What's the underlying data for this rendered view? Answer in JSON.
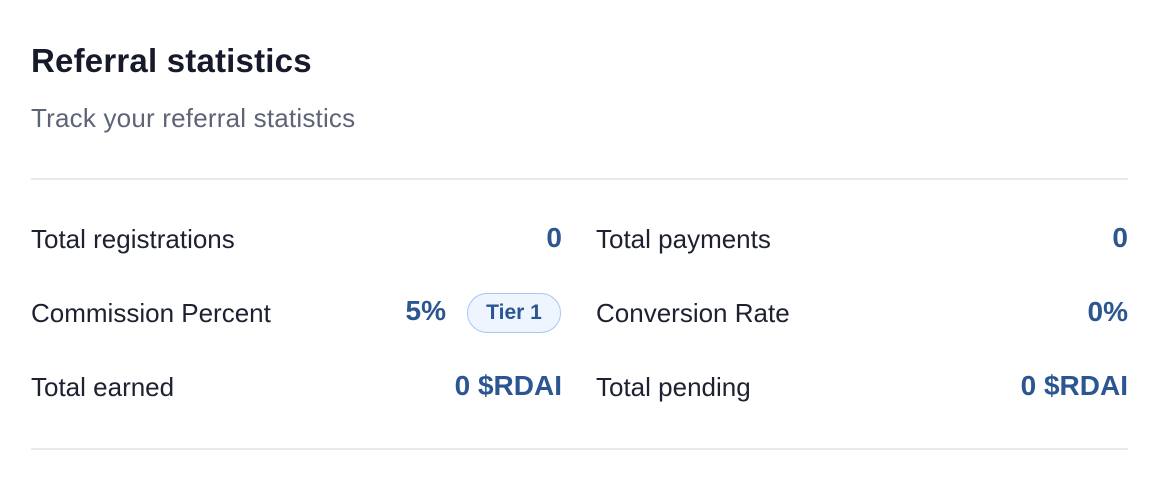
{
  "header": {
    "title": "Referral statistics",
    "subtitle": "Track your referral statistics"
  },
  "stats": {
    "total_registrations": {
      "label": "Total registrations",
      "value": "0"
    },
    "total_payments": {
      "label": "Total payments",
      "value": "0"
    },
    "commission_percent": {
      "label": "Commission Percent",
      "value": "5%",
      "badge": "Tier 1"
    },
    "conversion_rate": {
      "label": "Conversion Rate",
      "value": "0%"
    },
    "total_earned": {
      "label": "Total earned",
      "value": "0 $RDAI"
    },
    "total_pending": {
      "label": "Total pending",
      "value": "0 $RDAI"
    }
  },
  "colors": {
    "value_text": "#2c5691",
    "badge_border": "#a7c7ee",
    "badge_background": "#eef5fe",
    "divider": "#e7e9ee"
  }
}
